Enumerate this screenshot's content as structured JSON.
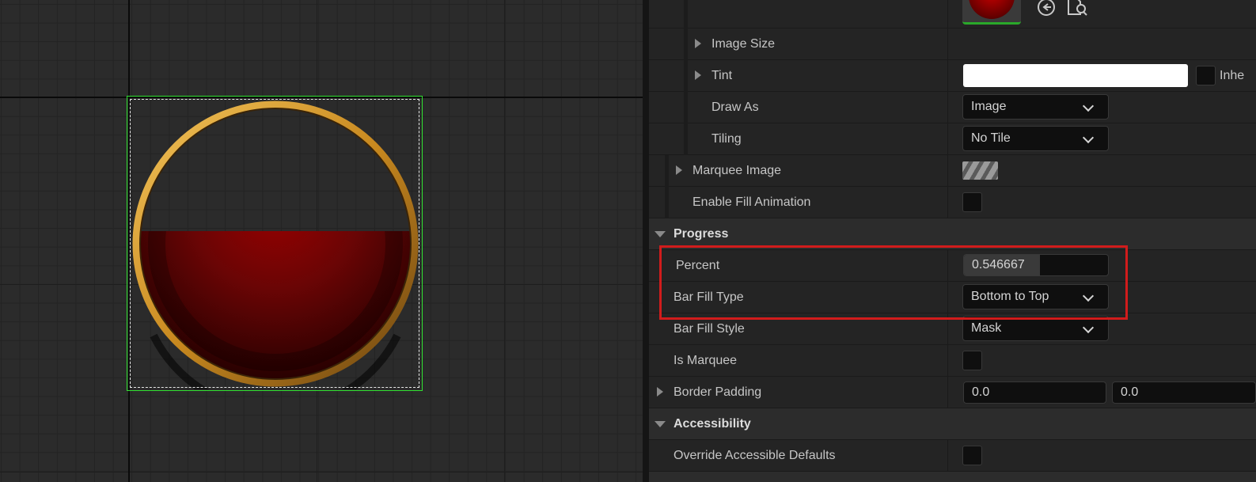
{
  "viewport": {
    "widget_name": "progress-bar-orb",
    "fill_percent": 0.546667,
    "colors": {
      "selection": "#31e131",
      "fill": "#8b0000",
      "ring": "#c8891f"
    }
  },
  "details": {
    "image_size_label": "Image Size",
    "tint_label": "Tint",
    "tint_inherit_label": "Inhe",
    "draw_as_label": "Draw As",
    "draw_as_value": "Image",
    "tiling_label": "Tiling",
    "tiling_value": "No Tile",
    "marquee_image_label": "Marquee Image",
    "enable_fill_animation_label": "Enable Fill Animation",
    "progress_section": "Progress",
    "percent_label": "Percent",
    "percent_value": "0.546667",
    "bar_fill_type_label": "Bar Fill Type",
    "bar_fill_type_value": "Bottom to Top",
    "bar_fill_style_label": "Bar Fill Style",
    "bar_fill_style_value": "Mask",
    "is_marquee_label": "Is Marquee",
    "border_padding_label": "Border Padding",
    "border_padding_x": "0.0",
    "border_padding_y": "0.0",
    "accessibility_section": "Accessibility",
    "override_accessible_label": "Override Accessible Defaults"
  },
  "icons": [
    "browse-back-icon",
    "find-in-browser-icon",
    "chevron-down-icon",
    "expand-arrow-icon",
    "collapse-arrow-icon"
  ],
  "highlight_color": "#d11c1c"
}
